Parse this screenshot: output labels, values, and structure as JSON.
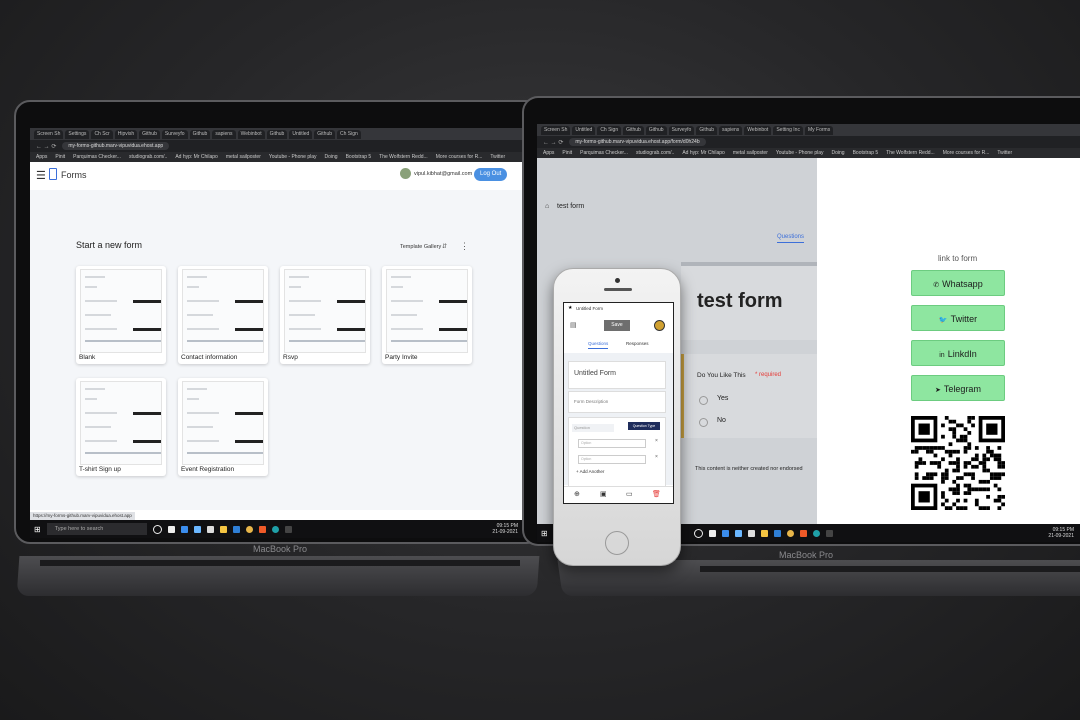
{
  "device_labels": {
    "left": "MacBook Pro",
    "right": "MacBook Pro"
  },
  "left_laptop": {
    "tabs": [
      "Screen Sh",
      "Settings",
      "Ch Scr",
      "Hipvish",
      "Github",
      "Surveyfo",
      "Github",
      "sapiens",
      "Webinbot",
      "Github",
      "Untitled",
      "Github",
      "Ch Sign"
    ],
    "url": "my-forms-github.marv-vipuvidua.ehost.app",
    "bookmarks": [
      "Apps",
      "Pinit",
      "Parquimas Checker...",
      "studiograb.com/..",
      "Ad hyp: Mr Chilapo",
      "metal sailposter",
      "Youtube - Phone play",
      "Doing",
      "Bootstrap 5",
      "The Wolfstern Redd...",
      "More courses for R...",
      "Twitter"
    ],
    "app_title": "Forms",
    "user_email": "vipul.kibhat@gmail.com",
    "logout_label": "Log Out",
    "section_title": "Start a new form",
    "template_gallery": "Template Gallery",
    "templates": [
      {
        "name": "Blank"
      },
      {
        "name": "Contact information"
      },
      {
        "name": "Rsvp"
      },
      {
        "name": "Party Invite"
      },
      {
        "name": "T-shirt Sign up"
      },
      {
        "name": "Event Registration"
      }
    ],
    "status_url": "https://my-forms-github.marv-vipuvidua.ehost.app",
    "taskbar_search": "Type here to search",
    "clock": {
      "time": "09:15 PM",
      "date": "21-09-2021"
    }
  },
  "right_laptop": {
    "tabs": [
      "Screen Sh",
      "Untitled",
      "Ch Sign",
      "Github",
      "Github",
      "Surveyfo",
      "Github",
      "sapiens",
      "Webinbot",
      "Setting Inc",
      "My Forms"
    ],
    "url": "my-forms-github.marv-vipuvidua.ehost.app/form/d0h24b",
    "bookmarks": [
      "Apps",
      "Pinit",
      "Parquimas Checker...",
      "studiograb.com/..",
      "Ad hyp: Mr Chilapo",
      "metal sailposter",
      "Youtube - Phone play",
      "Doing",
      "Bootstrap 5",
      "The Wolfstern Redd...",
      "More courses for R...",
      "Twitter"
    ],
    "form_title_small": "test form",
    "questions_tab": "Questions",
    "form_title": "test form",
    "question": "Do You Like This",
    "required": "* required",
    "options": [
      "Yes",
      "No"
    ],
    "disclaimer": "This content is neither created nor endorsed",
    "share_heading": "link to form",
    "share_buttons": [
      {
        "label": "Whatsapp",
        "icon": "whatsapp-icon"
      },
      {
        "label": "Twitter",
        "icon": "twitter-icon"
      },
      {
        "label": "LinkdIn",
        "icon": "linkedin-icon"
      },
      {
        "label": "Telegram",
        "icon": "telegram-icon"
      }
    ],
    "clock": {
      "time": "09:15 PM",
      "date": "21-09-2021"
    }
  },
  "phone": {
    "app_title": "Untitled Form",
    "save_label": "Save",
    "tabs": [
      "Questions",
      "Responses"
    ],
    "form_title": "Untitled Form",
    "form_description": "Form Description",
    "question_placeholder": "Question",
    "question_type": "Question Type",
    "option_placeholders": [
      "Option",
      "Option"
    ],
    "add_another": "Add Another"
  },
  "colors": {
    "accent_blue": "#4a90e2",
    "share_green": "#8ee6a0",
    "required_red": "#e53935",
    "question_type_bg": "#1f2d5c"
  }
}
